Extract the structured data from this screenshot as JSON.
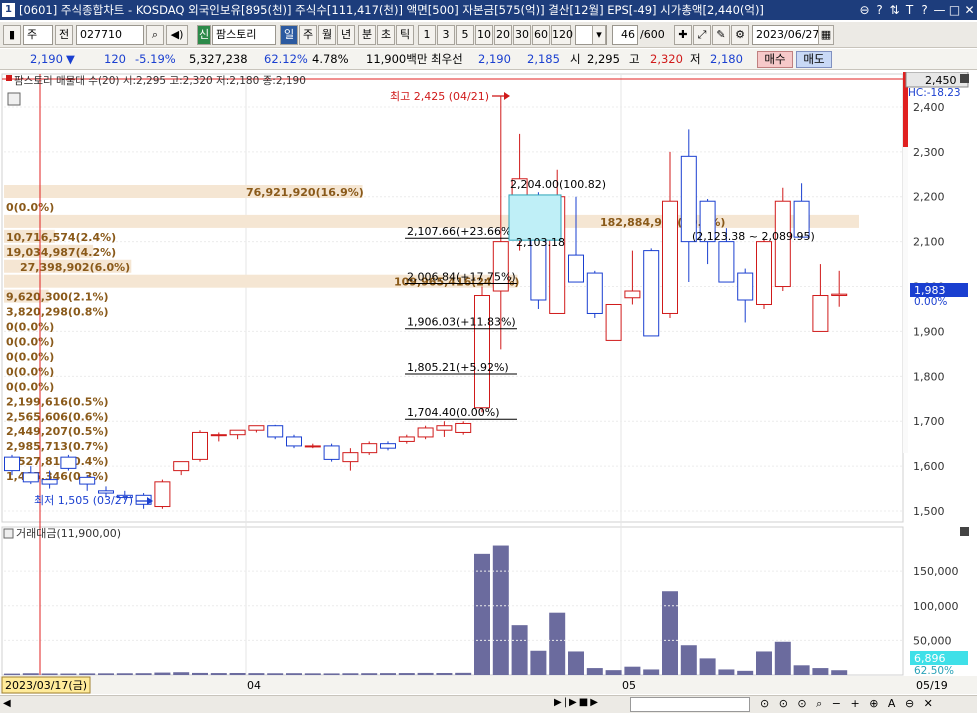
{
  "window": {
    "icon_label": "1",
    "title": "[0601] 주식종합차트 - KOSDAQ 외국인보유[895(천)] 주식수[111,417(천)] 액면[500] 자본금[575(억)] 결산[12월] EPS[-49] 시가총액[2,440(억)]",
    "buttons": [
      "⊖",
      "?",
      "⇅",
      "T",
      "?",
      "—",
      "□",
      "✕"
    ]
  },
  "toolbar": {
    "type_label": "주",
    "prev_label": "전",
    "code": "027710",
    "stock_name": "팜스토리",
    "new_label": "신",
    "periods": [
      "일",
      "주",
      "월",
      "년",
      "분",
      "초",
      "틱"
    ],
    "selected_period": "일",
    "intervals": [
      "1",
      "3",
      "5",
      "10",
      "20",
      "30",
      "60",
      "120"
    ],
    "count": "46",
    "count_max": "/600",
    "date": "2023/06/27"
  },
  "quote": {
    "price": "2,190",
    "arrow": "▼",
    "change": "120",
    "change_pct": "-5.19%",
    "volume": "5,327,238",
    "vol_ratio": "62.12%",
    "turnover": "4.78%",
    "amount": "11,900백만",
    "bid_label": "최우선",
    "bid1": "2,190",
    "bid2": "2,185",
    "open_label": "시",
    "open": "2,295",
    "high_label": "고",
    "high": "2,320",
    "low_label": "저",
    "low": "2,180",
    "buy_label": "매수",
    "sell_label": "매도"
  },
  "price_panel": {
    "legend": "팜스토리 매물대 수(20)  시:2,295 고:2,320 저:2,180 종:2,190",
    "current_tag": "2,450",
    "hc_label": "HC:-18.23",
    "last_price_tag": "1,983",
    "last_pct_tag": "0.00%",
    "high_note": "최고 2,425 (04/21)",
    "low_note": "최저 1,505 (03/27)",
    "y_ticks": [
      "2,400",
      "2,300",
      "2,200",
      "2,100",
      "2,000",
      "1,900",
      "1,800",
      "1,700",
      "1,600",
      "1,500"
    ],
    "box_label_top": "2,204.00(100.82)",
    "box_label_bottom": "2,103.18",
    "fib_levels": [
      "2,107.66(+23.66%)",
      "2,006.84(+17.75%)",
      "1,906.03(+11.83%)",
      "1,805.21(+5.92%)",
      "1,704.40(0.00%)"
    ],
    "range_label": "(2,123.38 ~ 2,089.95)",
    "volume_profile": [
      "76,921,920(16.9%)",
      "0(0.0%)",
      "182,884,978(40.3%)",
      "10,716,574(2.4%)",
      "19,034,987(4.2%)",
      "27,398,902(6.0%)",
      "109,965,416(24.2%)",
      "9,620,300(2.1%)",
      "3,820,298(0.8%)",
      "0(0.0%)",
      "0(0.0%)",
      "0(0.0%)",
      "0(0.0%)",
      "0(0.0%)",
      "2,199,616(0.5%)",
      "2,565,606(0.6%)",
      "2,449,207(0.5%)",
      "2,985,713(0.7%)",
      "1,527,816(0.4%)",
      "1,495,346(0.3%)"
    ]
  },
  "volume_panel": {
    "legend": "거래대금(11,900,00)",
    "y_ticks": [
      "150,000",
      "100,000",
      "50,000"
    ],
    "last_tag": "6,896",
    "last_pct": "62.50%"
  },
  "x_axis": {
    "start_date": "2023/03/17(금)",
    "labels": [
      "04",
      "05"
    ],
    "end_label": "05/19"
  },
  "colors": {
    "up": "#d01a1a",
    "down": "#1a3fd0",
    "volume_bar": "#6b6b9e",
    "profile_bar": "#f5e6d3",
    "box_fill": "#bfeff7"
  },
  "chart_data": {
    "type": "candlestick",
    "dates_start": "2023/03/17",
    "candles": [
      {
        "o": 1620,
        "h": 1625,
        "l": 1580,
        "c": 1590
      },
      {
        "o": 1585,
        "h": 1600,
        "l": 1560,
        "c": 1565
      },
      {
        "o": 1570,
        "h": 1590,
        "l": 1550,
        "c": 1560
      },
      {
        "o": 1620,
        "h": 1625,
        "l": 1590,
        "c": 1595
      },
      {
        "o": 1575,
        "h": 1580,
        "l": 1545,
        "c": 1560
      },
      {
        "o": 1545,
        "h": 1555,
        "l": 1530,
        "c": 1540
      },
      {
        "o": 1535,
        "h": 1545,
        "l": 1525,
        "c": 1530
      },
      {
        "o": 1535,
        "h": 1540,
        "l": 1505,
        "c": 1515
      },
      {
        "o": 1510,
        "h": 1570,
        "l": 1505,
        "c": 1565
      },
      {
        "o": 1590,
        "h": 1610,
        "l": 1580,
        "c": 1610
      },
      {
        "o": 1615,
        "h": 1680,
        "l": 1610,
        "c": 1675
      },
      {
        "o": 1670,
        "h": 1675,
        "l": 1655,
        "c": 1670
      },
      {
        "o": 1670,
        "h": 1680,
        "l": 1660,
        "c": 1680
      },
      {
        "o": 1680,
        "h": 1690,
        "l": 1675,
        "c": 1690
      },
      {
        "o": 1690,
        "h": 1692,
        "l": 1660,
        "c": 1665
      },
      {
        "o": 1665,
        "h": 1670,
        "l": 1640,
        "c": 1645
      },
      {
        "o": 1645,
        "h": 1650,
        "l": 1640,
        "c": 1645
      },
      {
        "o": 1645,
        "h": 1650,
        "l": 1610,
        "c": 1615
      },
      {
        "o": 1610,
        "h": 1640,
        "l": 1590,
        "c": 1630
      },
      {
        "o": 1630,
        "h": 1655,
        "l": 1625,
        "c": 1650
      },
      {
        "o": 1650,
        "h": 1655,
        "l": 1635,
        "c": 1640
      },
      {
        "o": 1655,
        "h": 1670,
        "l": 1650,
        "c": 1665
      },
      {
        "o": 1665,
        "h": 1690,
        "l": 1660,
        "c": 1685
      },
      {
        "o": 1680,
        "h": 1700,
        "l": 1665,
        "c": 1690
      },
      {
        "o": 1675,
        "h": 1700,
        "l": 1670,
        "c": 1695
      },
      {
        "o": 1730,
        "h": 2000,
        "l": 1720,
        "c": 1980
      },
      {
        "o": 1990,
        "h": 2425,
        "l": 1860,
        "c": 2100
      },
      {
        "o": 2110,
        "h": 2340,
        "l": 2080,
        "c": 2240
      },
      {
        "o": 2180,
        "h": 2210,
        "l": 1950,
        "c": 1970
      },
      {
        "o": 1940,
        "h": 2260,
        "l": 1940,
        "c": 2200
      },
      {
        "o": 2070,
        "h": 2200,
        "l": 2020,
        "c": 2010
      },
      {
        "o": 2030,
        "h": 2035,
        "l": 1930,
        "c": 1940
      },
      {
        "o": 1880,
        "h": 1960,
        "l": 1880,
        "c": 1960
      },
      {
        "o": 1975,
        "h": 2080,
        "l": 1960,
        "c": 1990
      },
      {
        "o": 2080,
        "h": 2085,
        "l": 1890,
        "c": 1890
      },
      {
        "o": 1940,
        "h": 2300,
        "l": 1930,
        "c": 2190
      },
      {
        "o": 2290,
        "h": 2350,
        "l": 2010,
        "c": 2100
      },
      {
        "o": 2190,
        "h": 2195,
        "l": 2050,
        "c": 2100
      },
      {
        "o": 2100,
        "h": 2130,
        "l": 2010,
        "c": 2010
      },
      {
        "o": 2030,
        "h": 2040,
        "l": 1920,
        "c": 1970
      },
      {
        "o": 1960,
        "h": 2105,
        "l": 1950,
        "c": 2100
      },
      {
        "o": 2000,
        "h": 2220,
        "l": 1990,
        "c": 2190
      },
      {
        "o": 2190,
        "h": 2230,
        "l": 2110,
        "c": 2110
      },
      {
        "o": 1900,
        "h": 2050,
        "l": 1900,
        "c": 1980
      },
      {
        "o": 1980,
        "h": 2035,
        "l": 1955,
        "c": 1983
      }
    ],
    "volume": [
      2000,
      2500,
      2200,
      2100,
      2300,
      2400,
      2500,
      2600,
      3500,
      4000,
      3000,
      2800,
      2900,
      2700,
      2500,
      2600,
      2400,
      2300,
      2500,
      2600,
      2700,
      2800,
      3000,
      2900,
      3100,
      175000,
      187000,
      72000,
      35000,
      90000,
      34000,
      10000,
      7000,
      12000,
      8000,
      121000,
      43000,
      24000,
      8000,
      6000,
      34000,
      48000,
      14000,
      10000,
      6896
    ],
    "ylim": [
      1480,
      2460
    ],
    "volume_ylim": [
      0,
      195000
    ]
  }
}
